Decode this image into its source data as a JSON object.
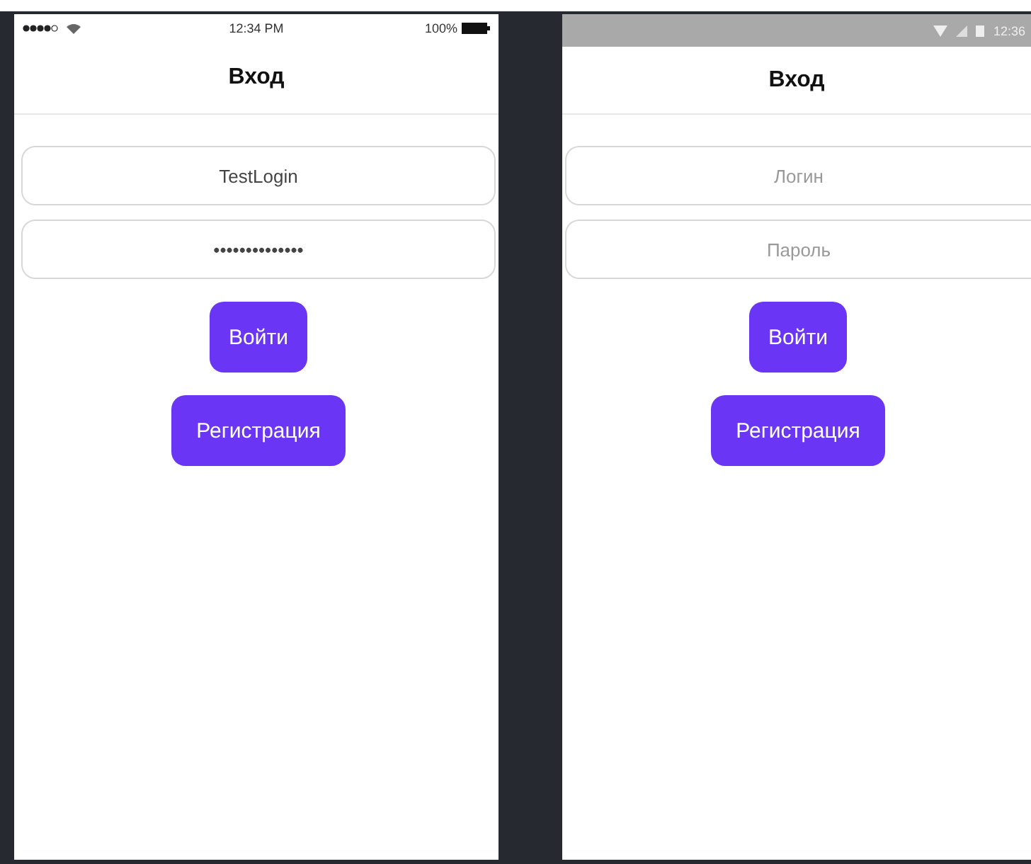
{
  "screens": [
    {
      "kind": "ios",
      "status_bar": {
        "time": "12:34 PM",
        "battery": "100%"
      },
      "title": "Вход",
      "fields": [
        {
          "value": "TestLogin"
        },
        {
          "value": "••••••••••••••"
        }
      ],
      "buttons": [
        "Войти",
        "Регистрация"
      ]
    },
    {
      "kind": "android",
      "status_bar": {
        "time": "12:36"
      },
      "title": "Вход",
      "fields": [
        {
          "placeholder": "Логин"
        },
        {
          "placeholder": "Пароль"
        }
      ],
      "buttons": [
        "Войти",
        "Регистрация"
      ]
    }
  ]
}
